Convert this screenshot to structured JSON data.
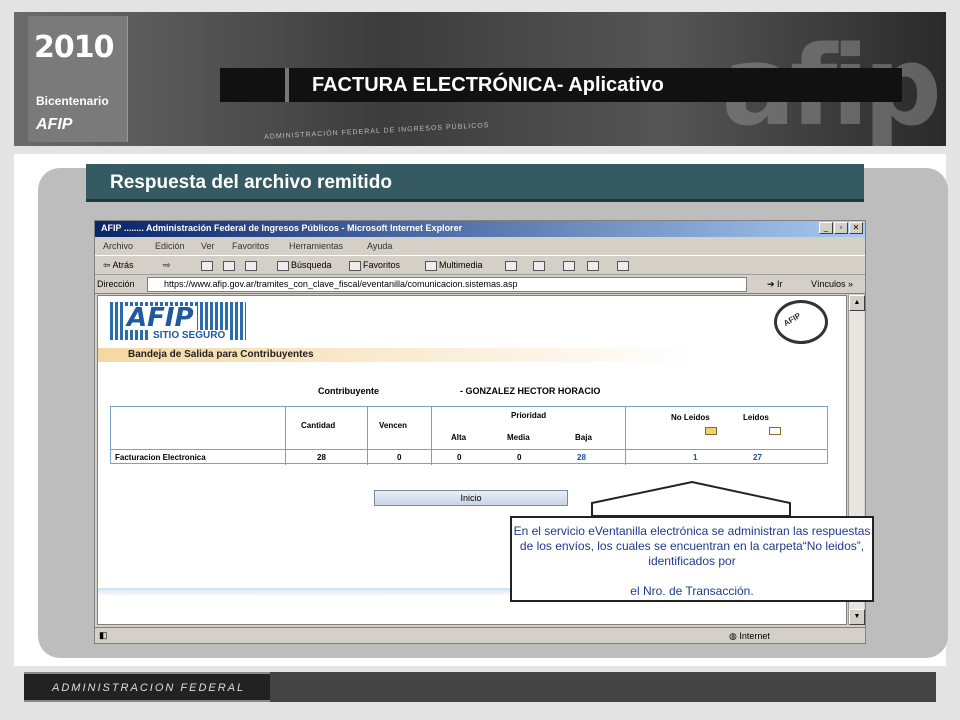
{
  "banner": {
    "logo_year": "2010",
    "logo_sub": "Bicentenario",
    "logo_brand": "AFIP",
    "big_text": "afip",
    "subtitle": "ADMINISTRACIÓN FEDERAL DE INGRESOS PÚBLICOS"
  },
  "title": "FACTURA ELECTRÓNICA- Aplicativo",
  "section_title": "Respuesta del archivo remitido",
  "browser": {
    "window_title": "AFIP ........ Administración Federal de Ingresos Públicos - Microsoft Internet Explorer",
    "menu": [
      "Archivo",
      "Edición",
      "Ver",
      "Favoritos",
      "Herramientas",
      "Ayuda"
    ],
    "toolbar": {
      "back": "Atrás",
      "search": "Búsqueda",
      "favorites": "Favoritos",
      "multimedia": "Multimedia"
    },
    "address_label": "Dirección",
    "address_value": "https://www.afip.gov.ar/tramites_con_clave_fiscal/eventanilla/comunicacion.sistemas.asp",
    "go_label": "Ir",
    "links_label": "Vínculos",
    "status_zone": "Internet"
  },
  "page": {
    "logo": "AFIP",
    "logo_sub": "SITIO SEGURO",
    "seal_text": "AFIP",
    "bandeja": "Bandeja de Salida para Contribuyentes",
    "contribuyente_label": "Contribuyente",
    "contribuyente_value": "- GONZALEZ HECTOR HORACIO",
    "table": {
      "headers": {
        "cantidad": "Cantidad",
        "vencen": "Vencen",
        "prioridad": "Prioridad",
        "alta": "Alta",
        "media": "Media",
        "baja": "Baja",
        "no_leidos": "No Leidos",
        "leidos": "Leidos"
      },
      "row": {
        "name": "Facturacion Electronica",
        "cantidad": "28",
        "vencen": "0",
        "alta": "0",
        "media": "0",
        "baja": "28",
        "no_leidos": "1",
        "leidos": "27"
      }
    },
    "inicio_button": "Inicio"
  },
  "callout": {
    "text": "En el servicio eVentanilla electrónica se administran las respuestas de los envíos, los cuales se encuentran en la carpeta“No leidos”, identificados por",
    "text2": "el Nro. de Transacción."
  },
  "footer": "ADMINISTRACION FEDERAL",
  "colors": {
    "section_bg": "#355a61",
    "callout_text": "#1e3a8c",
    "link_blue": "#1e4fa0"
  }
}
